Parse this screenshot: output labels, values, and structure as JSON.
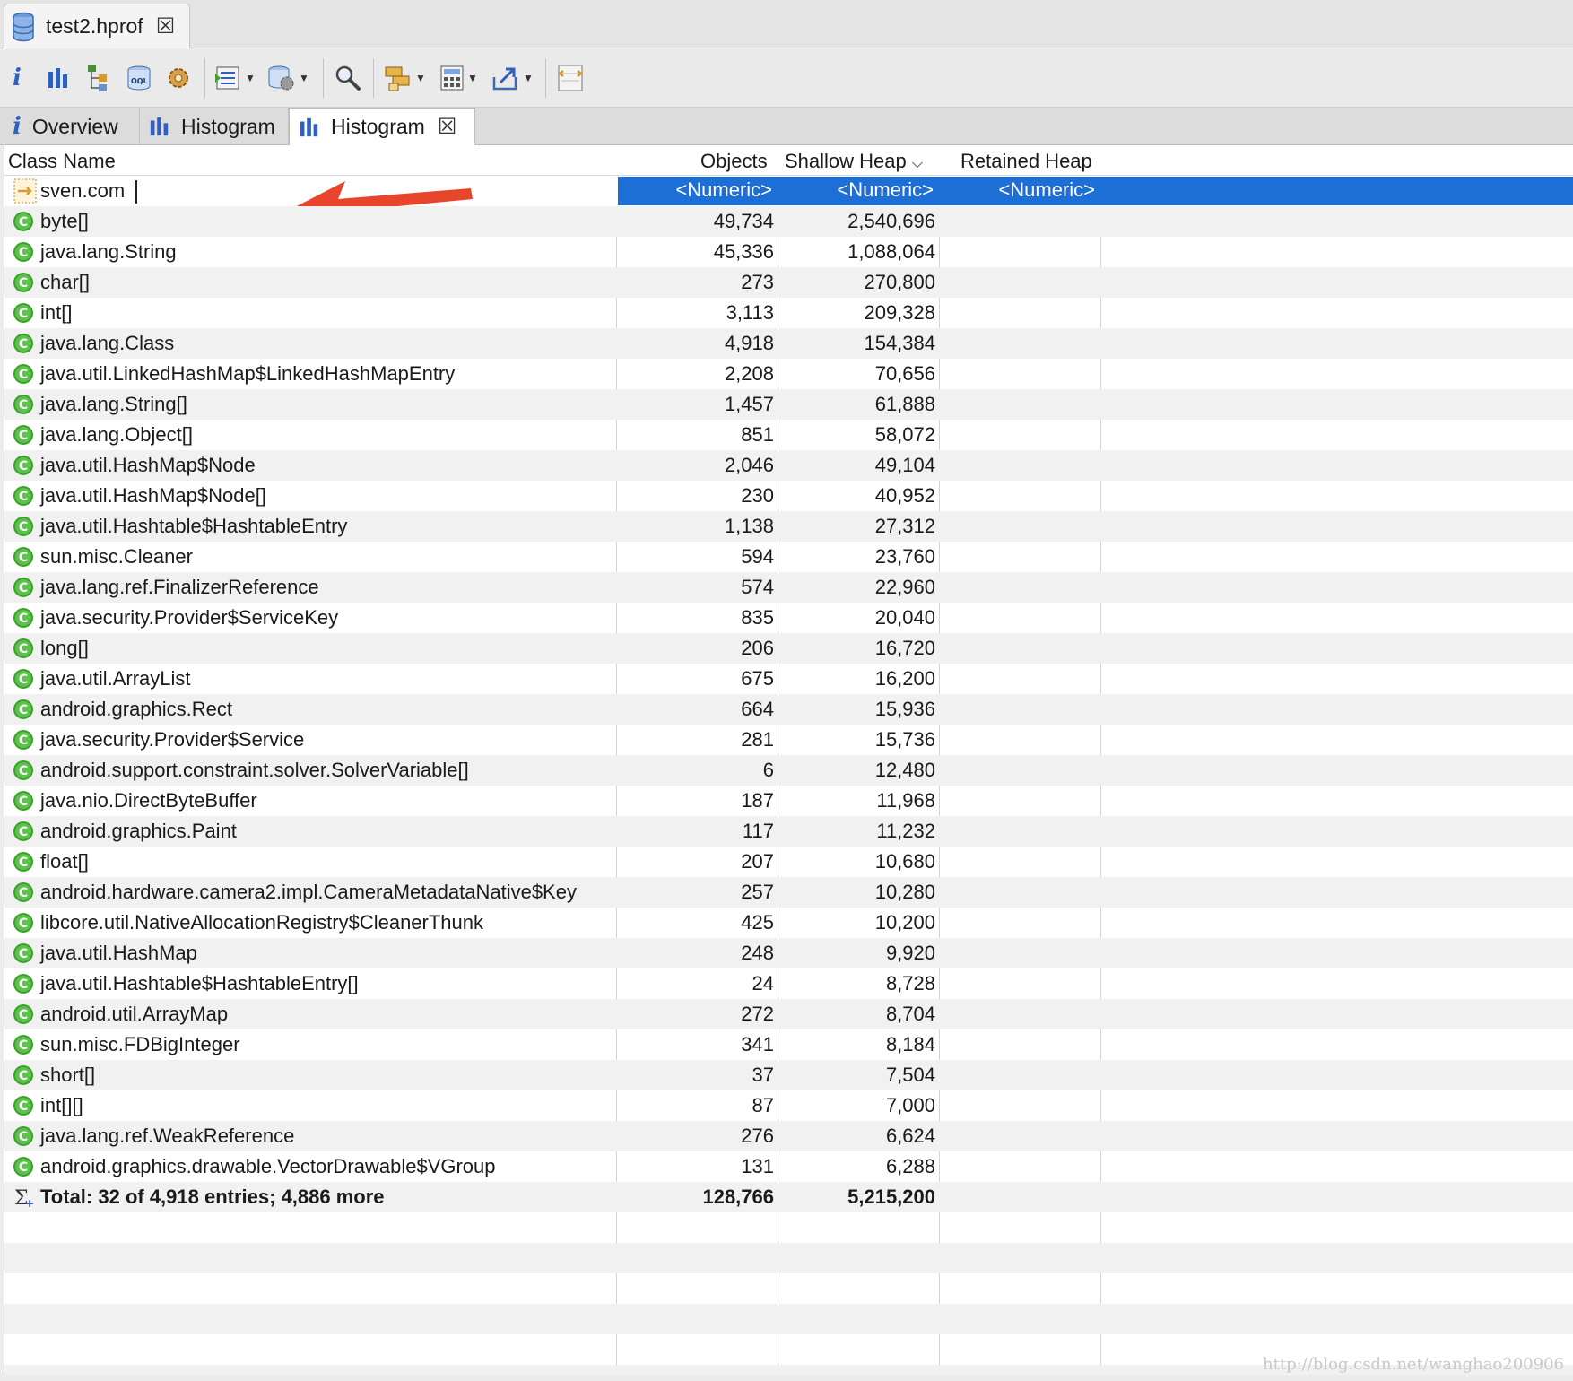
{
  "editor_tab": {
    "title": "test2.hprof",
    "icon": "database-icon"
  },
  "toolbar": {
    "buttons": [
      "info-icon",
      "histogram-icon",
      "dominator-tree-icon",
      "oql-icon",
      "settings-gear-icon",
      "query-browser-icon",
      "heap-dump-overview-icon",
      "search-icon",
      "group-icon",
      "calculate-icon",
      "export-icon",
      "compare-icon"
    ]
  },
  "inner_tabs": [
    {
      "label": "Overview",
      "icon": "info-icon"
    },
    {
      "label": "Histogram",
      "icon": "histogram-icon"
    },
    {
      "label": "Histogram",
      "icon": "histogram-icon",
      "active": true
    }
  ],
  "table": {
    "columns": {
      "class_name": "Class Name",
      "objects": "Objects",
      "shallow_heap": "Shallow Heap",
      "retained_heap": "Retained Heap"
    },
    "sort_indicator": "chevron-down",
    "filter": {
      "class_name": "sven.com",
      "objects": "<Numeric>",
      "shallow_heap": "<Numeric>",
      "retained_heap": "<Numeric>"
    },
    "rows": [
      {
        "name": "byte[]",
        "objects": "49,734",
        "shallow": "2,540,696"
      },
      {
        "name": "java.lang.String",
        "objects": "45,336",
        "shallow": "1,088,064"
      },
      {
        "name": "char[]",
        "objects": "273",
        "shallow": "270,800"
      },
      {
        "name": "int[]",
        "objects": "3,113",
        "shallow": "209,328"
      },
      {
        "name": "java.lang.Class",
        "objects": "4,918",
        "shallow": "154,384"
      },
      {
        "name": "java.util.LinkedHashMap$LinkedHashMapEntry",
        "objects": "2,208",
        "shallow": "70,656"
      },
      {
        "name": "java.lang.String[]",
        "objects": "1,457",
        "shallow": "61,888"
      },
      {
        "name": "java.lang.Object[]",
        "objects": "851",
        "shallow": "58,072"
      },
      {
        "name": "java.util.HashMap$Node",
        "objects": "2,046",
        "shallow": "49,104"
      },
      {
        "name": "java.util.HashMap$Node[]",
        "objects": "230",
        "shallow": "40,952"
      },
      {
        "name": "java.util.Hashtable$HashtableEntry",
        "objects": "1,138",
        "shallow": "27,312"
      },
      {
        "name": "sun.misc.Cleaner",
        "objects": "594",
        "shallow": "23,760"
      },
      {
        "name": "java.lang.ref.FinalizerReference",
        "objects": "574",
        "shallow": "22,960"
      },
      {
        "name": "java.security.Provider$ServiceKey",
        "objects": "835",
        "shallow": "20,040"
      },
      {
        "name": "long[]",
        "objects": "206",
        "shallow": "16,720"
      },
      {
        "name": "java.util.ArrayList",
        "objects": "675",
        "shallow": "16,200"
      },
      {
        "name": "android.graphics.Rect",
        "objects": "664",
        "shallow": "15,936"
      },
      {
        "name": "java.security.Provider$Service",
        "objects": "281",
        "shallow": "15,736"
      },
      {
        "name": "android.support.constraint.solver.SolverVariable[]",
        "objects": "6",
        "shallow": "12,480"
      },
      {
        "name": "java.nio.DirectByteBuffer",
        "objects": "187",
        "shallow": "11,968"
      },
      {
        "name": "android.graphics.Paint",
        "objects": "117",
        "shallow": "11,232"
      },
      {
        "name": "float[]",
        "objects": "207",
        "shallow": "10,680"
      },
      {
        "name": "android.hardware.camera2.impl.CameraMetadataNative$Key",
        "objects": "257",
        "shallow": "10,280"
      },
      {
        "name": "libcore.util.NativeAllocationRegistry$CleanerThunk",
        "objects": "425",
        "shallow": "10,200"
      },
      {
        "name": "java.util.HashMap",
        "objects": "248",
        "shallow": "9,920"
      },
      {
        "name": "java.util.Hashtable$HashtableEntry[]",
        "objects": "24",
        "shallow": "8,728"
      },
      {
        "name": "android.util.ArrayMap",
        "objects": "272",
        "shallow": "8,704"
      },
      {
        "name": "sun.misc.FDBigInteger",
        "objects": "341",
        "shallow": "8,184"
      },
      {
        "name": "short[]",
        "objects": "37",
        "shallow": "7,504"
      },
      {
        "name": "int[][]",
        "objects": "87",
        "shallow": "7,000"
      },
      {
        "name": "java.lang.ref.WeakReference",
        "objects": "276",
        "shallow": "6,624"
      },
      {
        "name": "android.graphics.drawable.VectorDrawable$VGroup",
        "objects": "131",
        "shallow": "6,288"
      }
    ],
    "total": {
      "label": "Total: 32 of 4,918 entries; 4,886 more",
      "objects": "128,766",
      "shallow": "5,215,200"
    }
  },
  "colors": {
    "selection": "#1d6fd6",
    "annotation_arrow": "#e8452d",
    "class_icon": "#3aa12a"
  },
  "watermark": "http://blog.csdn.net/wanghao200906"
}
